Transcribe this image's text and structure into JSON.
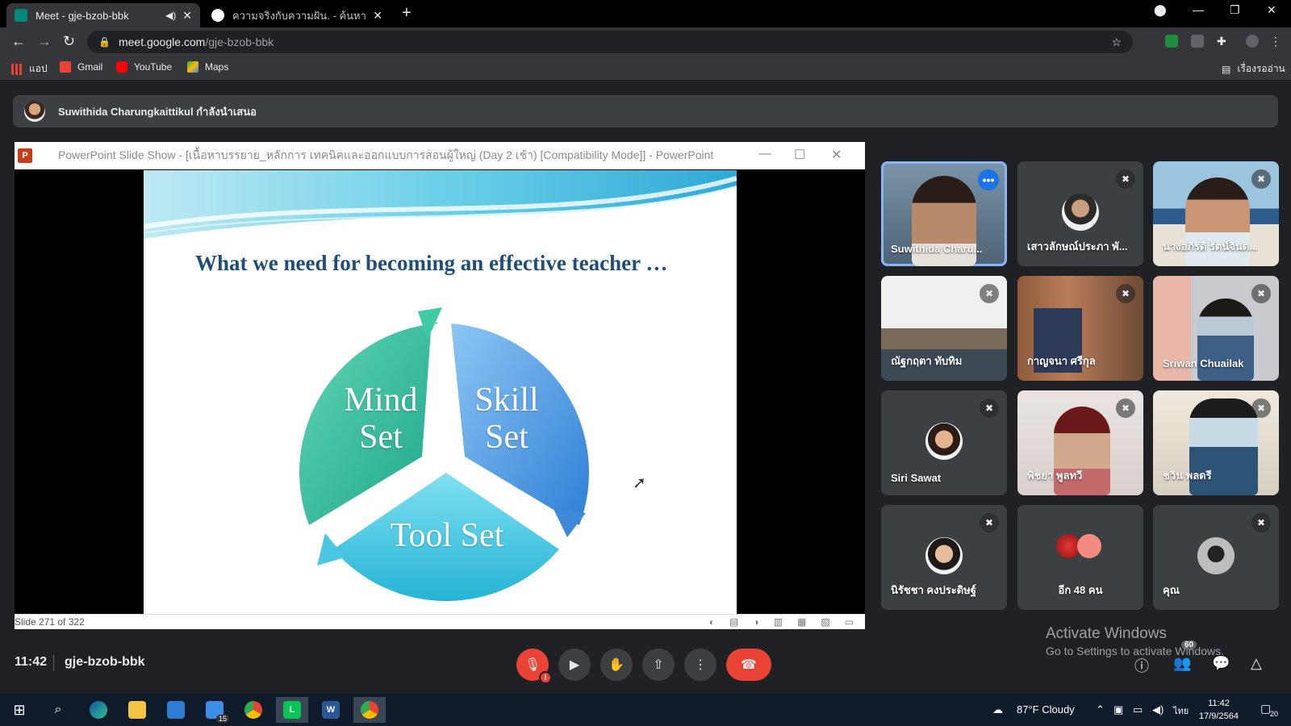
{
  "browser": {
    "tabs": [
      {
        "title": "Meet - gje-bzob-bbk",
        "active": true
      },
      {
        "title": "ความจริงกับความฝัน. - ค้นหาด้วย Goo",
        "active": false
      }
    ],
    "url_host": "meet.google.com",
    "url_path": "/gje-bzob-bbk",
    "bookmarks": [
      "แอป",
      "Gmail",
      "YouTube",
      "Maps"
    ],
    "reading_list": "เรื่องรออ่าน"
  },
  "presenting_banner": "Suwithida Charungkaittikul กำลังนำเสนอ",
  "powerpoint": {
    "logo": "P",
    "window_title": "PowerPoint Slide Show - [เนื้อหาบรรยาย_หลักการ เทคนิคและออกแบบการสอนผู้ใหญ่ (Day 2 เช้า) [Compatibility Mode]] - PowerPoint",
    "slide_title": "What we need for becoming an effective teacher …",
    "cycle": {
      "mind_line1": "Mind",
      "mind_line2": "Set",
      "skill_line1": "Skill",
      "skill_line2": "Set",
      "tool": "Tool Set"
    },
    "status": "Slide 271 of 322"
  },
  "participants": [
    {
      "name": "Suwithida Charu...",
      "speaking": true
    },
    {
      "name": "เสาวลักษณ์ประภา พั..."
    },
    {
      "name": "นางอภิรดี รัตน์จินด..."
    },
    {
      "name": "ณัฐกฤตา ทับทิม"
    },
    {
      "name": "กาญจนา ศรีกุล"
    },
    {
      "name": "Sriwan Chuailak"
    },
    {
      "name": "Siri Sawat"
    },
    {
      "name": "พิชยา พูลทวี"
    },
    {
      "name": "ชวิน พลดรี"
    },
    {
      "name": "นิรัชชา คงประดิษฐ์"
    },
    {
      "name": "อีก 48 คน"
    },
    {
      "name": "คุณ"
    }
  ],
  "meeting": {
    "time": "11:42",
    "code": "gje-bzob-bbk",
    "people_count": "60"
  },
  "activate_windows": {
    "line1": "Activate Windows",
    "line2": "Go to Settings to activate Windows."
  },
  "taskbar": {
    "mail_badge": "15",
    "weather": "87°F  Cloudy",
    "lang": "ไทย",
    "clock_time": "11:42",
    "clock_date": "17/9/2564",
    "notif_count": "20"
  }
}
